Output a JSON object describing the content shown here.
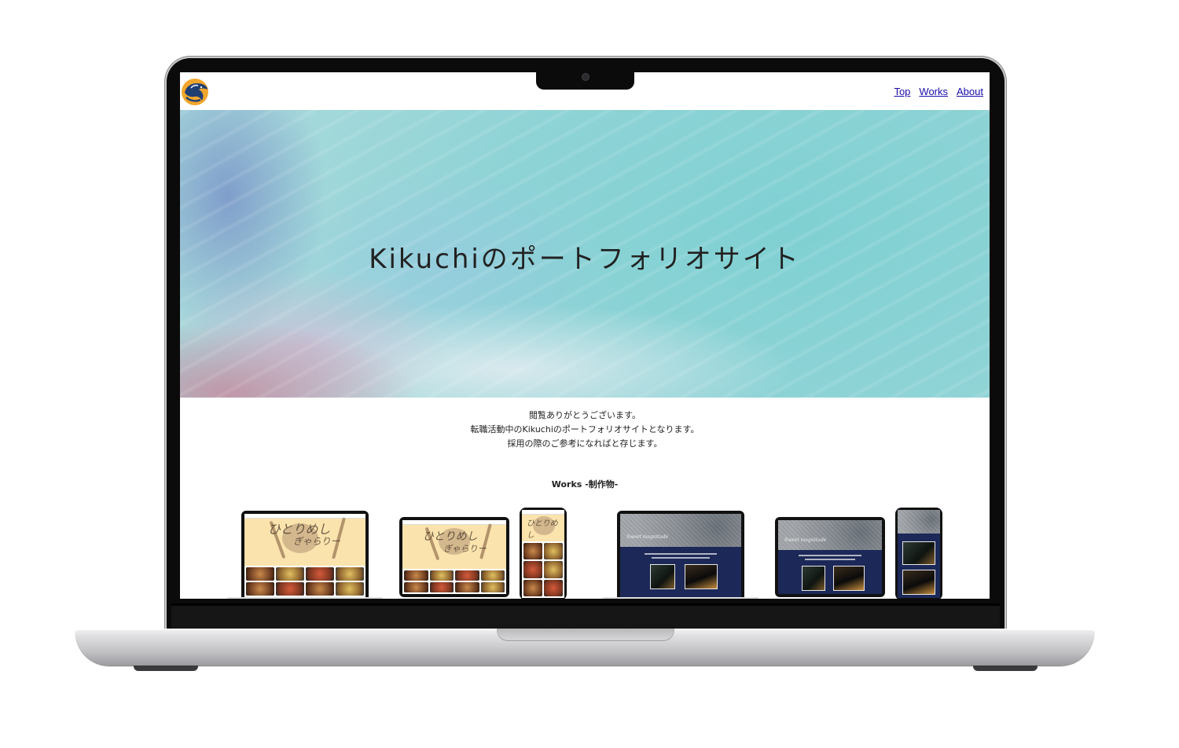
{
  "site": {
    "logo_icon": "dolphin-logo-icon",
    "nav": [
      {
        "label": "Top"
      },
      {
        "label": "Works"
      },
      {
        "label": "About"
      }
    ],
    "hero_title": "Kikuchiのポートフォリオサイト",
    "intro": [
      "閲覧ありがとうございます。",
      "転職活動中のKikuchiのポートフォリオサイトとなります。",
      "採用の際のご参考になればと存じます。"
    ],
    "works_heading": "Works -制作物-"
  },
  "colors": {
    "link": "#1a0dab",
    "text": "#222222",
    "frame": "#0b0b0b",
    "food_site_bg": "#fbe3ad",
    "cafe_site_bg": "#1c2857"
  },
  "works": [
    {
      "name": "food-gallery-site",
      "devices": [
        "laptop",
        "tablet",
        "phone"
      ]
    },
    {
      "name": "cafe-site",
      "devices": [
        "laptop",
        "tablet",
        "phone"
      ]
    }
  ]
}
